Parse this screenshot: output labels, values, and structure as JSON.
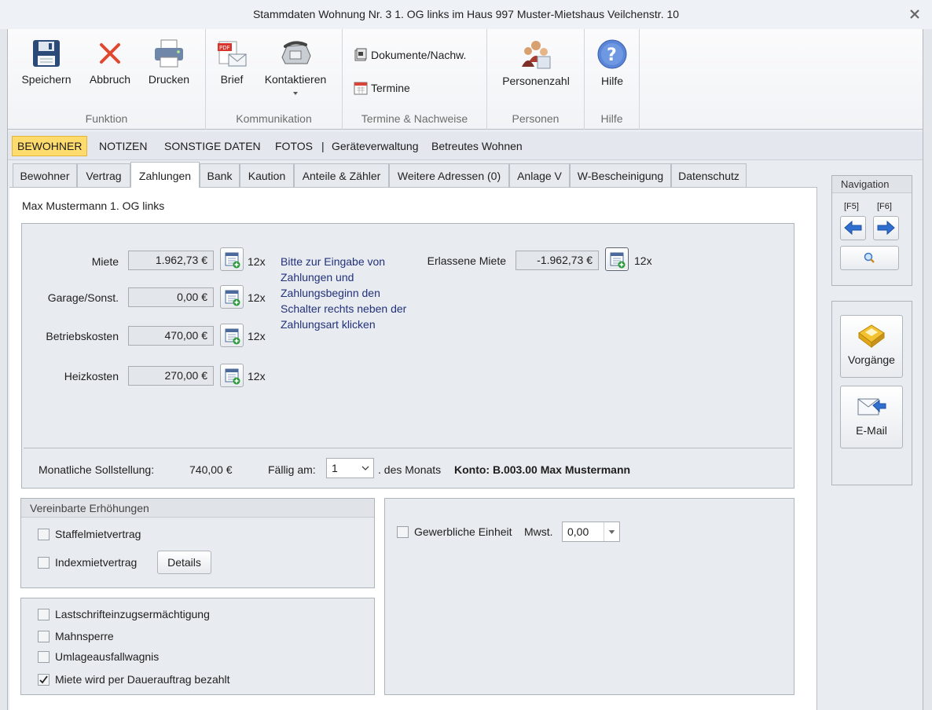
{
  "window": {
    "title": "Stammdaten Wohnung Nr. 3 1. OG links im Haus 997  Muster-Mietshaus Veilchenstr. 10"
  },
  "ribbon": {
    "groups": [
      {
        "label": "Funktion",
        "buttons": [
          "Speichern",
          "Abbruch",
          "Drucken"
        ]
      },
      {
        "label": "Kommunikation",
        "buttons": [
          "Brief",
          "Kontaktieren"
        ]
      },
      {
        "label": "Termine & Nachweise",
        "buttons": [
          "Dokumente/Nachw.",
          "Termine"
        ]
      },
      {
        "label": "Personen",
        "buttons": [
          "Personenzahl"
        ]
      },
      {
        "label": "Hilfe",
        "buttons": [
          "Hilfe"
        ]
      }
    ]
  },
  "subnav": [
    "BEWOHNER",
    "NOTIZEN",
    "SONSTIGE DATEN",
    "FOTOS",
    "|",
    "Geräteverwaltung",
    "Betreutes Wohnen"
  ],
  "tabs": [
    "Bewohner",
    "Vertrag",
    "Zahlungen",
    "Bank",
    "Kaution",
    "Anteile & Zähler",
    "Weitere Adressen (0)",
    "Anlage V",
    "W-Bescheinigung",
    "Datenschutz"
  ],
  "owner": "Max Mustermann 1. OG links",
  "payments": [
    {
      "label": "Miete",
      "value": "1.962,73 €",
      "times": "12x"
    },
    {
      "label": "Garage/Sonst.",
      "value": "0,00 €",
      "times": "12x"
    },
    {
      "label": "Betriebskosten",
      "value": "470,00 €",
      "times": "12x"
    },
    {
      "label": "Heizkosten",
      "value": "270,00 €",
      "times": "12x"
    }
  ],
  "hint": "Bitte zur Eingabe von Zahlungen und Zahlungsbeginn den Schalter rechts neben der Zahlungsart klicken",
  "waived": {
    "label": "Erlassene Miete",
    "value": "-1.962,73 €",
    "times": "12x"
  },
  "footer": {
    "sollstellung_label": "Monatliche Sollstellung:",
    "sollstellung_value": "740,00 €",
    "faellig_label": "Fällig am:",
    "faellig_value": "1",
    "monat_label": ". des Monats",
    "konto": "Konto: B.003.00 Max Mustermann"
  },
  "increases": {
    "title": "Vereinbarte Erhöhungen",
    "staffel": "Staffelmietvertrag",
    "index": "Indexmietvertrag",
    "details": "Details"
  },
  "options": [
    {
      "label": "Lastschrifteinzugsermächtigung",
      "checked": false
    },
    {
      "label": "Mahnsperre",
      "checked": false
    },
    {
      "label": "Umlageausfallwagnis",
      "checked": false
    },
    {
      "label": "Miete wird per Dauerauftrag bezahlt",
      "checked": true
    }
  ],
  "gewerbe": {
    "label": "Gewerbliche Einheit",
    "mwst_label": "Mwst.",
    "mwst_value": "0,00"
  },
  "navigation": {
    "title": "Navigation",
    "prev_key": "[F5]",
    "next_key": "[F6]"
  },
  "actions": {
    "vorgaenge": "Vorgänge",
    "email": "E-Mail"
  },
  "colors": {
    "accent": "#fddc6d",
    "hint_text": "#22317a",
    "nav_arrow": "#2f6fd0"
  }
}
